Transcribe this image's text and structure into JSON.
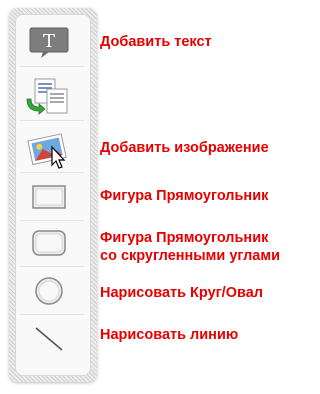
{
  "toolbar": {
    "tools": [
      {
        "icon": "text-icon",
        "glyph": "T",
        "label": "Добавить текст"
      },
      {
        "icon": "copy-icon",
        "label": ""
      },
      {
        "icon": "image-icon",
        "label": "Добавить изображение"
      },
      {
        "icon": "rectangle-icon",
        "label": "Фигура Прямоугольник"
      },
      {
        "icon": "rounded-rectangle-icon",
        "label_line1": "Фигура Прямоугольник",
        "label_line2": "со скругленными углами"
      },
      {
        "icon": "circle-icon",
        "label": "Нарисовать Круг/Овал"
      },
      {
        "icon": "line-icon",
        "label": "Нарисовать линию"
      }
    ]
  },
  "colors": {
    "label_red": "#e60000",
    "text_icon_bg": "#7d7d7d",
    "shape_stroke": "#8a8a8a"
  }
}
